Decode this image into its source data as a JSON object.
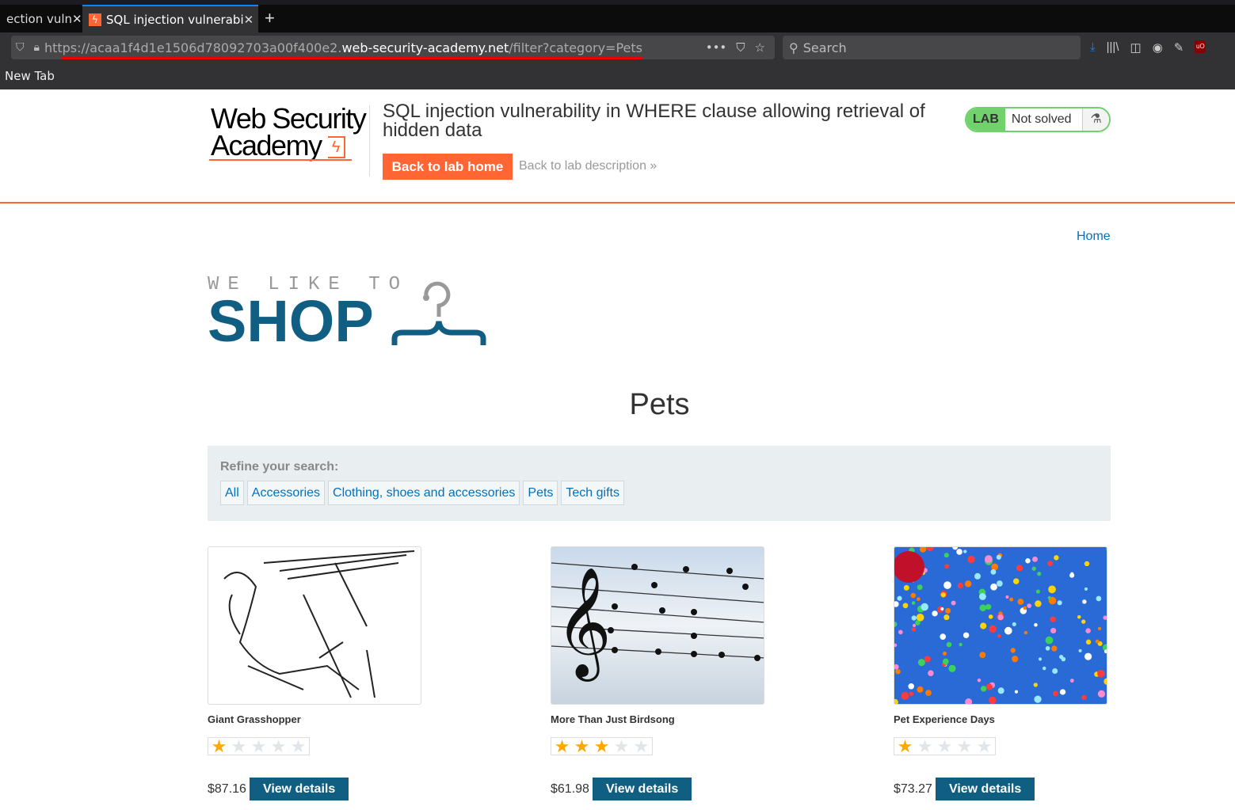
{
  "browser": {
    "tabs": [
      {
        "label": "ection vuln",
        "close": "✕"
      },
      {
        "label": "SQL injection vulnerabi",
        "close": "✕"
      }
    ],
    "new_tab": "+",
    "url": {
      "prefix": "https://acaa1f4d1e1506d78092703a00f400e2.",
      "domain": "web-security-academy.net",
      "path": "/filter?category=Pets"
    },
    "search_placeholder": "Search",
    "bookmark": "New Tab"
  },
  "header": {
    "logo": {
      "line1": "Web Security",
      "line2": "Academy"
    },
    "lab_title": "SQL injection vulnerability in WHERE clause allowing retrieval of hidden data",
    "back_home": "Back to lab home",
    "back_desc": "Back to lab description »",
    "status": {
      "badge": "LAB",
      "text": "Not solved"
    },
    "colors": {
      "accent": "#ff6633",
      "status": "#70d16d"
    }
  },
  "nav": {
    "home": "Home"
  },
  "shop_logo": {
    "tagline": "WE LIKE TO",
    "word": "SHOP"
  },
  "category_title": "Pets",
  "filters": {
    "label": "Refine your search:",
    "items": [
      "All",
      "Accessories",
      "Clothing, shoes and accessories",
      "Pets",
      "Tech gifts"
    ]
  },
  "products": [
    {
      "name": "Giant Grasshopper",
      "rating": 1,
      "price": "$87.16",
      "button": "View details"
    },
    {
      "name": "More Than Just Birdsong",
      "rating": 3,
      "price": "$61.98",
      "button": "View details"
    },
    {
      "name": "Pet Experience Days",
      "rating": 1,
      "price": "$73.27",
      "button": "View details"
    }
  ],
  "brand_color": "#105f83"
}
